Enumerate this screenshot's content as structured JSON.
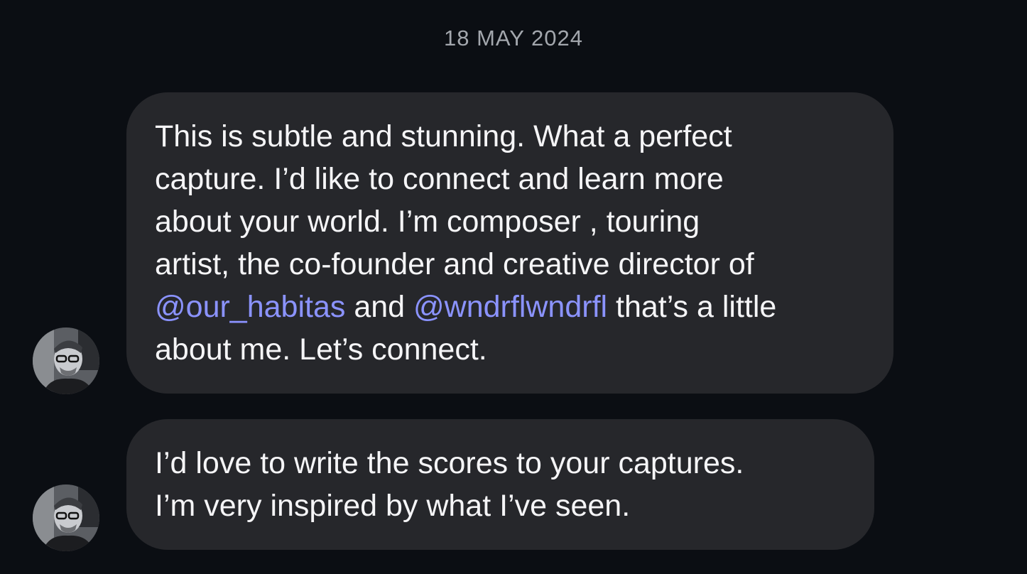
{
  "date_separator": "18 MAY 2024",
  "messages": [
    {
      "lines": [
        {
          "text": "This is subtle and stunning.  What a perfect"
        },
        {
          "text": "capture.  I’d like to connect and learn more"
        },
        {
          "text": "about your world.  I’m composer , touring"
        },
        {
          "text": "artist, the co-founder and creative director of"
        },
        {
          "mention1": "@our_habitas",
          "mid": " and ",
          "mention2": "@wndrflwndrfl",
          "tail": " that’s a little"
        },
        {
          "text": "about me.  Let’s connect."
        }
      ]
    },
    {
      "lines": [
        {
          "text": "I’d love to write the scores to your captures."
        },
        {
          "text": "I’m very inspired by what I’ve seen."
        }
      ]
    }
  ],
  "colors": {
    "background": "#0b0e13",
    "bubble": "#26272b",
    "mention": "#8b93ff",
    "date": "#a3a7ad"
  },
  "icons": {
    "sender_avatar": "avatar-photo"
  }
}
